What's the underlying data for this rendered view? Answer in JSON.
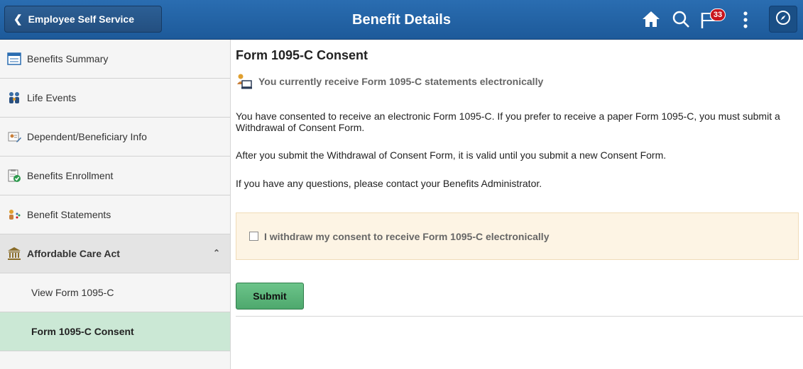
{
  "header": {
    "back_label": "Employee Self Service",
    "title": "Benefit Details",
    "notification_count": "33",
    "icons": [
      "home-icon",
      "search-icon",
      "notifications-flag-icon",
      "actions-menu-icon",
      "navbar-compass-icon"
    ]
  },
  "sidebar": {
    "items": [
      {
        "label": "Benefits Summary",
        "icon": "benefits-summary-icon"
      },
      {
        "label": "Life Events",
        "icon": "life-events-icon"
      },
      {
        "label": "Dependent/Beneficiary Info",
        "icon": "dependent-info-icon"
      },
      {
        "label": "Benefits Enrollment",
        "icon": "enrollment-icon"
      },
      {
        "label": "Benefit Statements",
        "icon": "statements-icon"
      }
    ],
    "group": {
      "label": "Affordable Care Act",
      "icon": "bank-building-icon",
      "expanded": true
    },
    "sub_items": [
      {
        "label": "View Form 1095-C",
        "active": false
      },
      {
        "label": "Form 1095-C Consent",
        "active": true
      }
    ]
  },
  "main": {
    "title": "Form 1095-C Consent",
    "status": "You currently receive Form 1095-C statements electronically",
    "paragraph1": "You have consented to receive an electronic Form 1095-C.  If you prefer to receive a paper Form 1095-C, you must submit a Withdrawal of Consent Form.",
    "paragraph2": "After you submit the Withdrawal of Consent Form, it is valid until you submit a new Consent Form.",
    "paragraph3": "If you have any questions, please contact your Benefits Administrator.",
    "withdraw_label": "I withdraw my consent to receive Form 1095-C electronically",
    "withdraw_checked": false,
    "submit_label": "Submit"
  },
  "colors": {
    "banner": "#2a6db1",
    "active_sidebar": "#cbe8d5",
    "submit": "#5bb67a",
    "consent_box": "#fdf4e4",
    "badge": "#c8151d"
  }
}
